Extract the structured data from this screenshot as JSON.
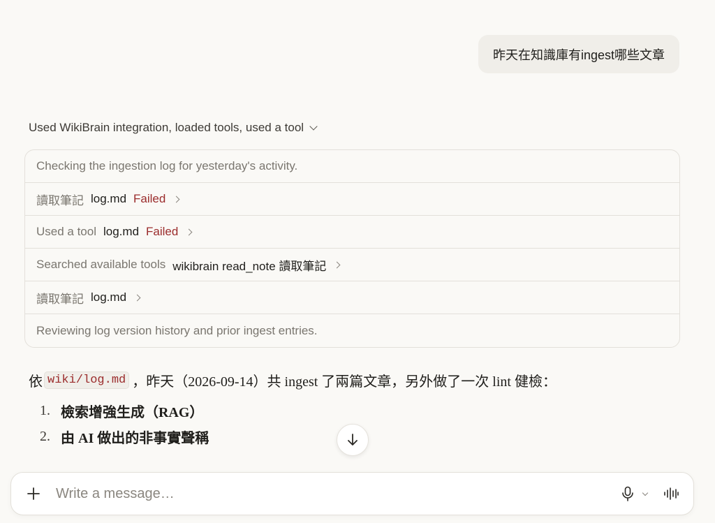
{
  "user_message": "昨天在知識庫有ingest哪些文章",
  "tools_summary": {
    "label": "Used WikiBrain integration, loaded tools, used a tool"
  },
  "steps": [
    {
      "text": "Checking the ingestion log for yesterday's activity."
    },
    {
      "action": "讀取筆記",
      "target": "log.md",
      "status": "Failed"
    },
    {
      "action": "Used a tool",
      "target": "log.md",
      "status": "Failed"
    },
    {
      "action": "Searched available tools",
      "target": "wikibrain read_note 讀取筆記"
    },
    {
      "action": "讀取筆記",
      "target": "log.md"
    },
    {
      "text": "Reviewing log version history and prior ingest entries."
    }
  ],
  "response": {
    "prefix": "依",
    "code": "wiki/log.md",
    "suffix": "，昨天（2026-09-14）共 ingest 了兩篇文章，另外做了一次 lint 健檢：",
    "items": [
      {
        "num": "1.",
        "text": "檢索增強生成（RAG）"
      },
      {
        "num": "2.",
        "text": "由 AI 做出的非事實聲稱"
      }
    ]
  },
  "composer": {
    "placeholder": "Write a message…"
  },
  "colors": {
    "background": "#faf9f6",
    "failed": "#9b2c2c",
    "muted": "#7a766f",
    "border": "#e3e0da"
  }
}
